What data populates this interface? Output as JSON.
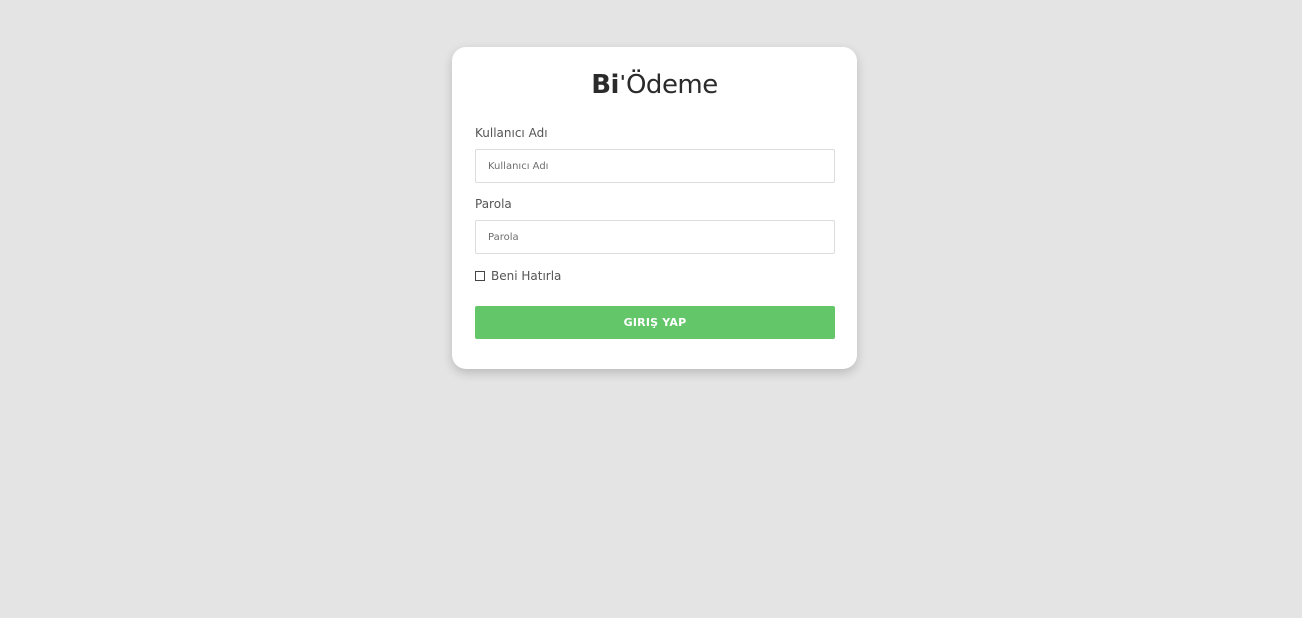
{
  "brand": {
    "part1": "Bi",
    "tick": "'",
    "part2": "Ödeme"
  },
  "form": {
    "username_label": "Kullanıcı Adı",
    "username_placeholder": "Kullanıcı Adı",
    "username_value": "",
    "password_label": "Parola",
    "password_placeholder": "Parola",
    "password_value": "",
    "remember_label": "Beni Hatırla",
    "remember_checked": false,
    "submit_label": "GIRIŞ YAP"
  },
  "colors": {
    "background": "#e4e4e4",
    "card": "#ffffff",
    "accent": "#63c76a",
    "text": "#555555",
    "logo": "#2b2b2b"
  }
}
